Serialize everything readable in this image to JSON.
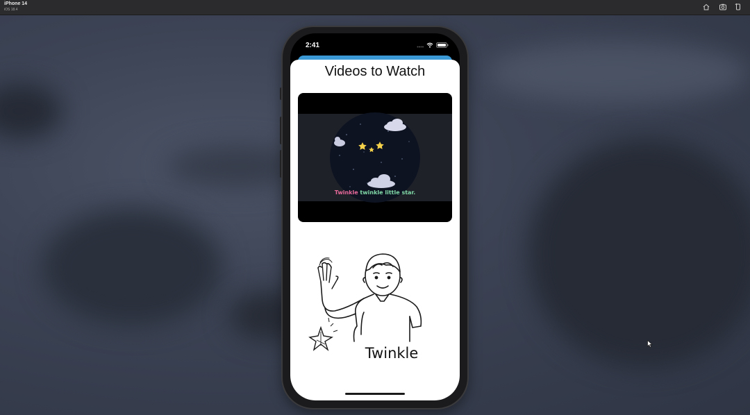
{
  "simulator": {
    "device_name": "iPhone 14",
    "os_version": "iOS 18.4",
    "toolbar_icons": [
      "home-icon",
      "screenshot-icon",
      "rotate-icon"
    ]
  },
  "status_bar": {
    "time": "2:41",
    "icons": [
      "signal-icon",
      "wifi-icon",
      "battery-icon"
    ]
  },
  "screen": {
    "title": "Videos to Watch",
    "video": {
      "caption_word1": "Twinkle",
      "caption_rest": " twinkle little star."
    },
    "illustration": {
      "label": "Twinkle"
    }
  },
  "colors": {
    "sheet_accent": "#3b9ad6",
    "caption_pink": "#e86a9a",
    "caption_green": "#7fd7a6"
  }
}
